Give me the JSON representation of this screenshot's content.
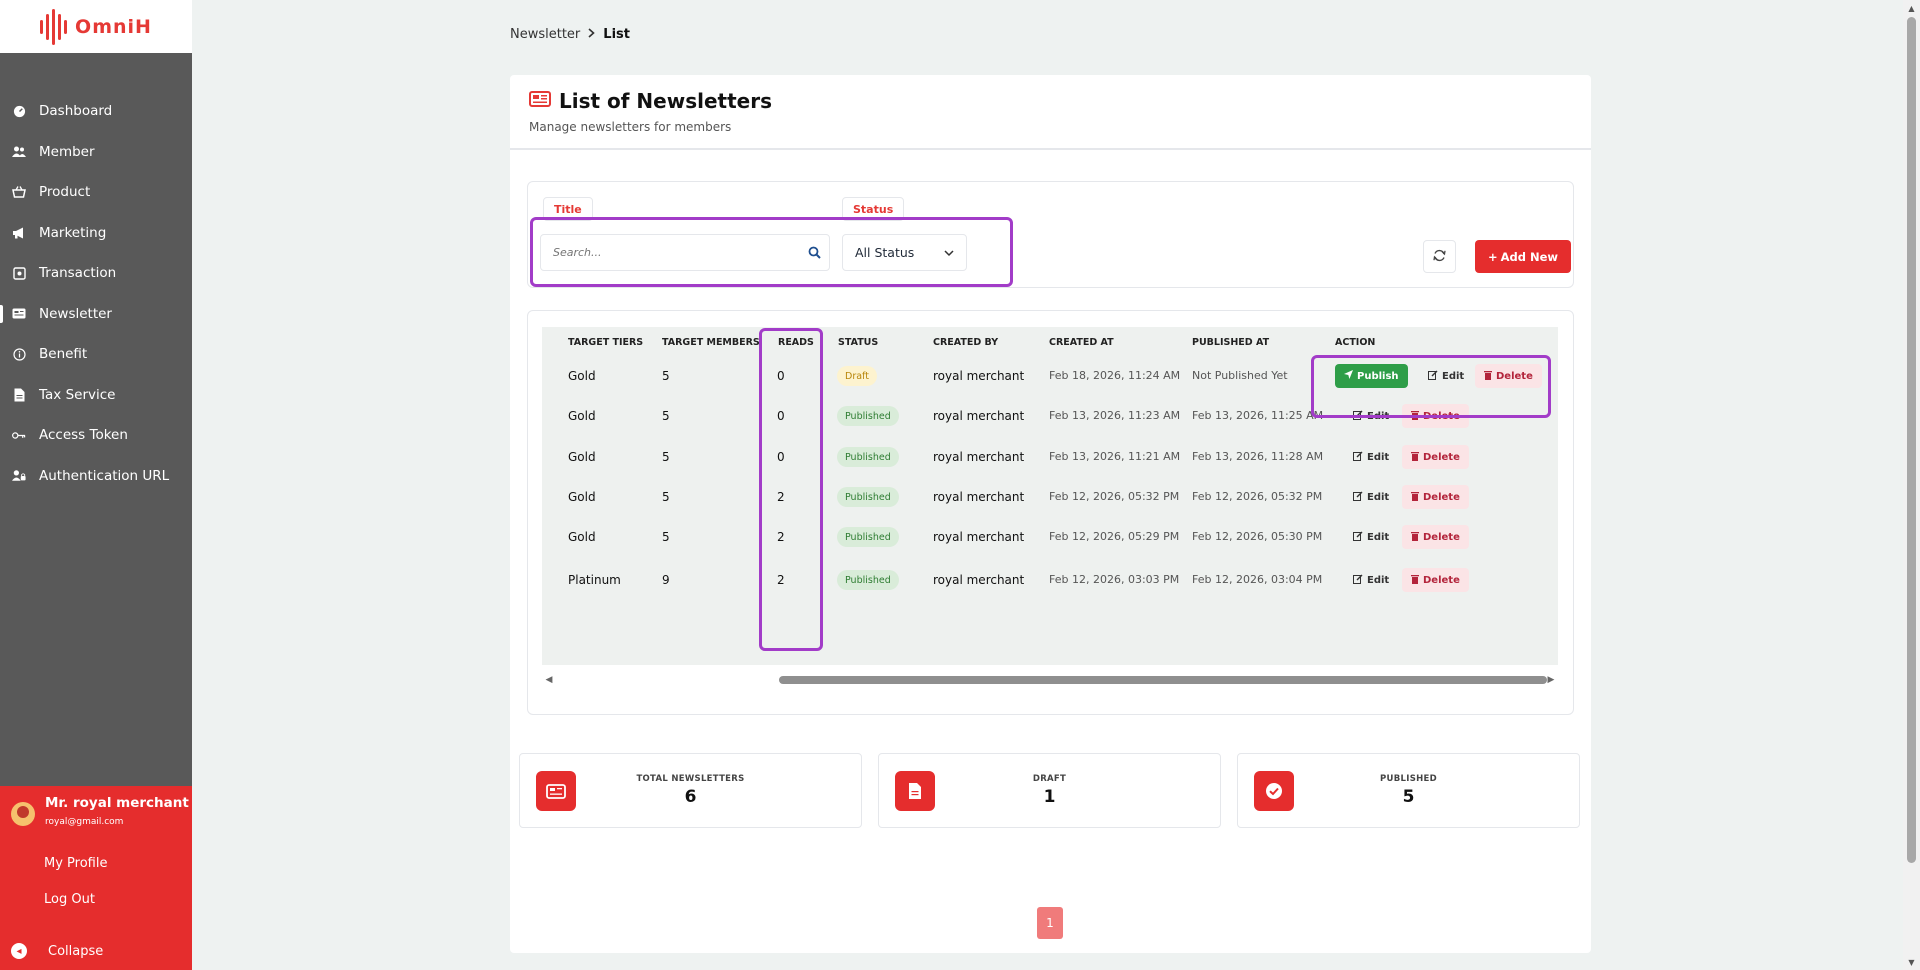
{
  "app": {
    "logo_text": "OmniH"
  },
  "sidebar": {
    "items": [
      {
        "label": "Dashboard",
        "icon": "dashboard-icon"
      },
      {
        "label": "Member",
        "icon": "users-icon"
      },
      {
        "label": "Product",
        "icon": "basket-icon"
      },
      {
        "label": "Marketing",
        "icon": "megaphone-icon"
      },
      {
        "label": "Transaction",
        "icon": "receipt-icon"
      },
      {
        "label": "Newsletter",
        "icon": "newspaper-icon",
        "active": true
      },
      {
        "label": "Benefit",
        "icon": "info-icon"
      },
      {
        "label": "Tax Service",
        "icon": "document-icon"
      },
      {
        "label": "Access Token",
        "icon": "key-icon"
      },
      {
        "label": "Authentication URL",
        "icon": "user-lock-icon"
      }
    ]
  },
  "user": {
    "name": "Mr. royal merchant",
    "email": "royal@gmail.com",
    "profile_label": "My Profile",
    "logout_label": "Log Out",
    "collapse_label": "Collapse"
  },
  "breadcrumb": {
    "parent": "Newsletter",
    "current": "List"
  },
  "page": {
    "title": "List of Newsletters",
    "subtitle": "Manage newsletters for members"
  },
  "filters": {
    "title_label": "Title",
    "status_label": "Status",
    "search_placeholder": "Search...",
    "status_value": "All Status",
    "add_new_label": "Add New"
  },
  "table": {
    "headers": {
      "tiers": "TARGET TIERS",
      "members": "TARGET MEMBERS",
      "reads": "READS",
      "status": "STATUS",
      "created_by": "CREATED BY",
      "created_at": "CREATED AT",
      "published_at": "PUBLISHED AT",
      "action": "ACTION"
    },
    "rows": [
      {
        "tiers": "Gold",
        "members": "5",
        "reads": "0",
        "status": "Draft",
        "created_by": "royal merchant",
        "created_at": "Feb 18, 2026, 11:24 AM",
        "published_at": "Not Published Yet"
      },
      {
        "tiers": "Gold",
        "members": "5",
        "reads": "0",
        "status": "Published",
        "created_by": "royal merchant",
        "created_at": "Feb 13, 2026, 11:23 AM",
        "published_at": "Feb 13, 2026, 11:25 AM"
      },
      {
        "tiers": "Gold",
        "members": "5",
        "reads": "0",
        "status": "Published",
        "created_by": "royal merchant",
        "created_at": "Feb 13, 2026, 11:21 AM",
        "published_at": "Feb 13, 2026, 11:28 AM"
      },
      {
        "tiers": "Gold",
        "members": "5",
        "reads": "2",
        "status": "Published",
        "created_by": "royal merchant",
        "created_at": "Feb 12, 2026, 05:32 PM",
        "published_at": "Feb 12, 2026, 05:32 PM"
      },
      {
        "tiers": "Gold",
        "members": "5",
        "reads": "2",
        "status": "Published",
        "created_by": "royal merchant",
        "created_at": "Feb 12, 2026, 05:29 PM",
        "published_at": "Feb 12, 2026, 05:30 PM"
      },
      {
        "tiers": "Platinum",
        "members": "9",
        "reads": "2",
        "status": "Published",
        "created_by": "royal merchant",
        "created_at": "Feb 12, 2026, 03:03 PM",
        "published_at": "Feb 12, 2026, 03:04 PM"
      }
    ],
    "actions": {
      "publish": "Publish",
      "edit": "Edit",
      "delete": "Delete"
    }
  },
  "stats": [
    {
      "label": "TOTAL NEWSLETTERS",
      "value": "6",
      "icon": "newspaper-icon"
    },
    {
      "label": "DRAFT",
      "value": "1",
      "icon": "file-icon"
    },
    {
      "label": "PUBLISHED",
      "value": "5",
      "icon": "check-circle-icon"
    }
  ],
  "pagination": {
    "current": "1"
  },
  "colors": {
    "brand": "#e53935",
    "sidebar": "#595959",
    "publish": "#2e9e48",
    "highlight": "#a23cc8"
  }
}
